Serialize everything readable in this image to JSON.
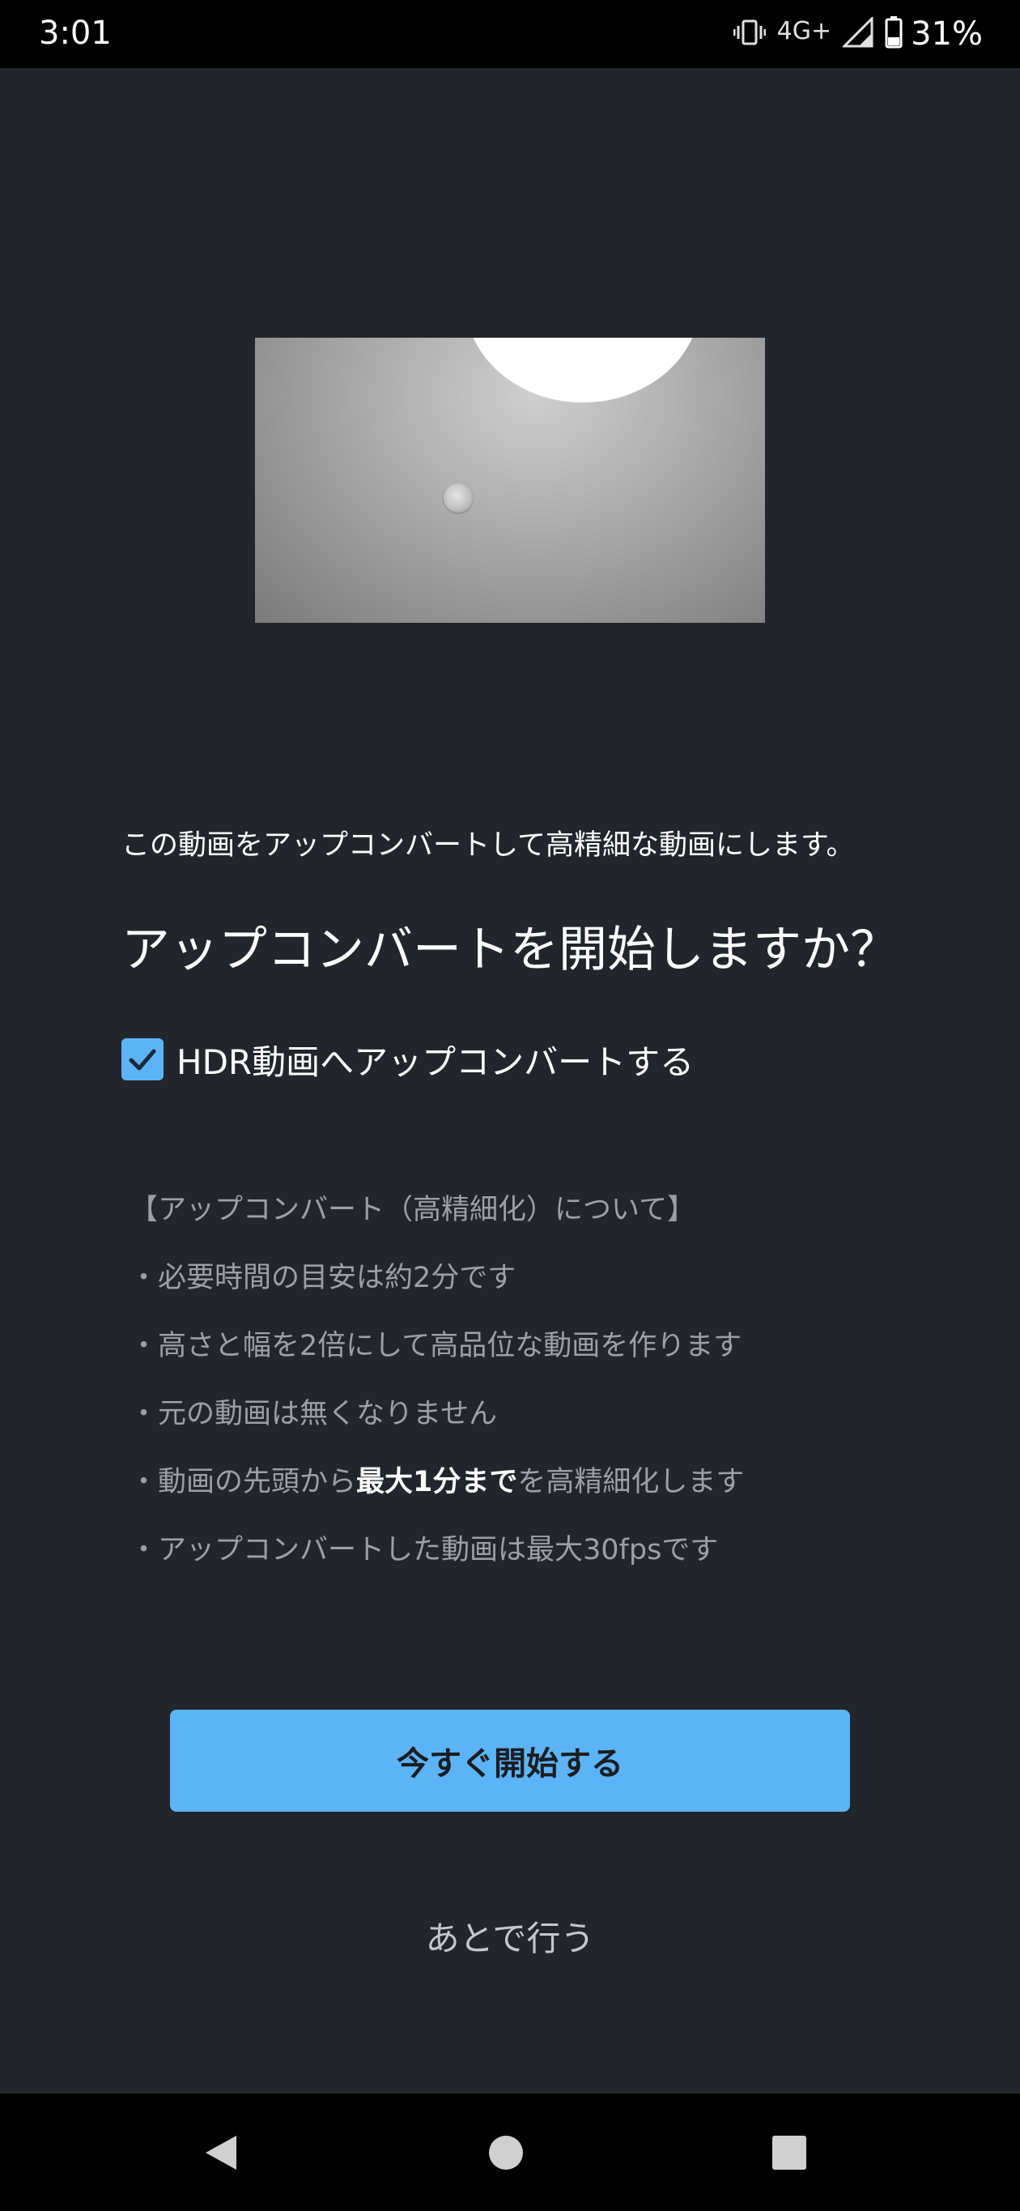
{
  "status_bar": {
    "time": "3:01",
    "network": "4G+",
    "battery": "31%",
    "icons": [
      "vibrate-icon",
      "signal-icon",
      "battery-icon"
    ]
  },
  "preview": {
    "icon": "video-thumbnail"
  },
  "dialog": {
    "description": "この動画をアップコンバートして高精細な動画にします。",
    "question": "アップコンバートを開始しますか？",
    "hdr_checkbox": {
      "label": "HDR動画へアップコンバートする",
      "checked": true
    },
    "info": {
      "heading": "【アップコンバート（高精細化）について】",
      "line1": "・必要時間の目安は約2分です",
      "line2": "・高さと幅を2倍にして高品位な動画を作ります",
      "line3": "・元の動画は無くなりません",
      "line4_pre": "・動画の先頭から",
      "line4_bold": "最大1分まで",
      "line4_post": "を高精細化します",
      "line5": "・アップコンバートした動画は最大30fpsです"
    },
    "start_button": "今すぐ開始する",
    "later_button": "あとで行う"
  },
  "nav_bar": {
    "buttons": [
      "back-icon",
      "home-icon",
      "recents-icon"
    ]
  },
  "colors": {
    "background": "#22262c",
    "accent": "#5cb4f7",
    "secondary_text": "#9aa0a6"
  }
}
